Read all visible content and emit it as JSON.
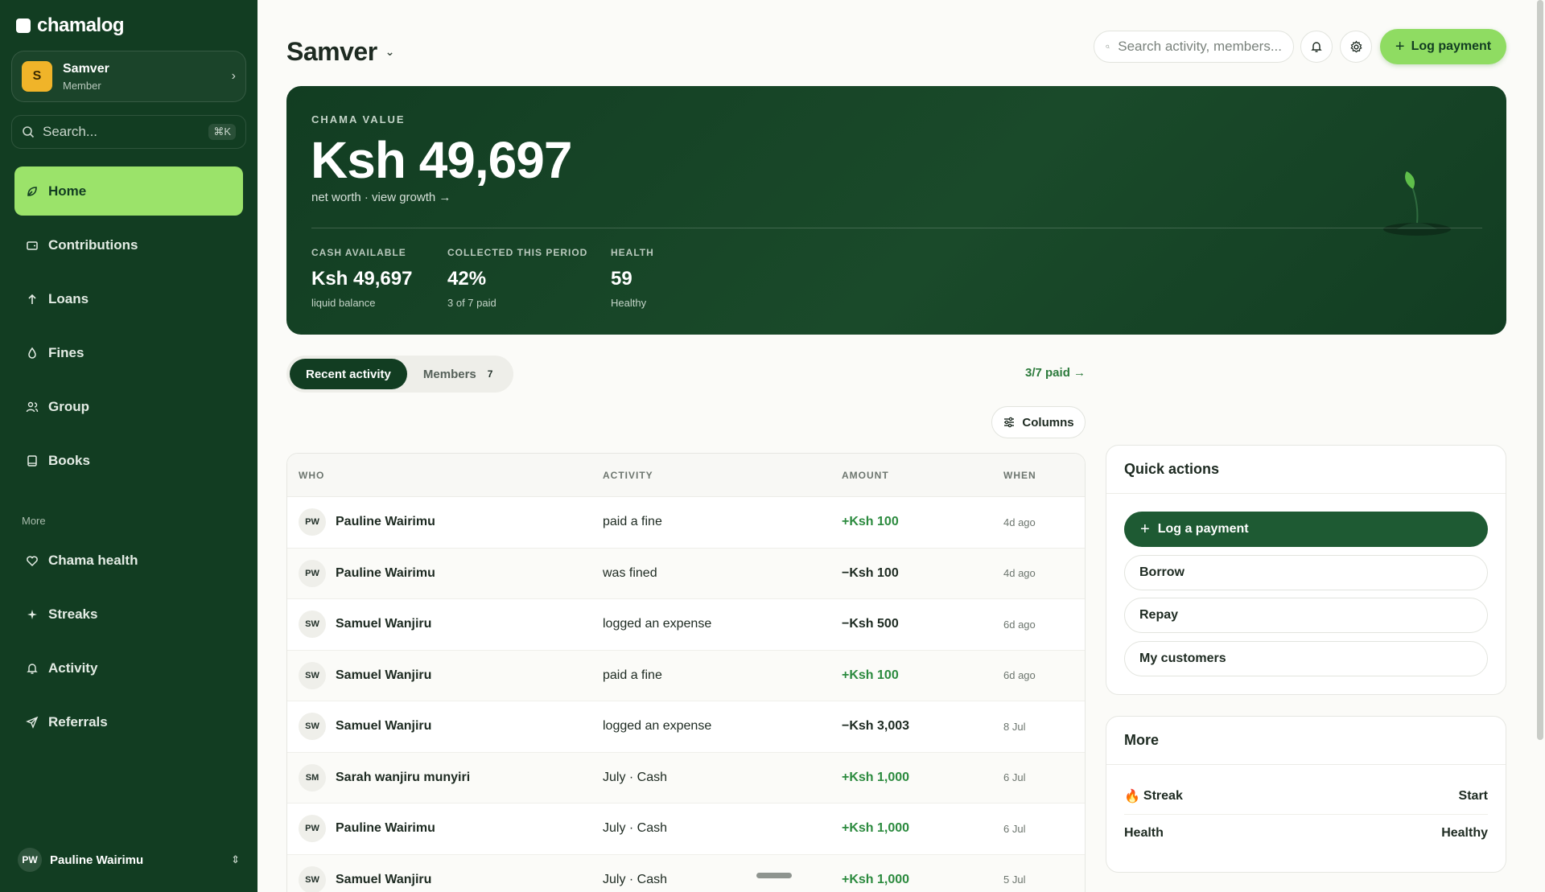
{
  "app": {
    "logo_text": "chamalog"
  },
  "sidebar": {
    "org": {
      "avatar_letter": "S",
      "name": "Samver",
      "role": "Member"
    },
    "search": {
      "placeholder": "Search...",
      "shortcut": "⌘K"
    },
    "nav": [
      {
        "label": "Home",
        "icon": "leaf-icon",
        "active": true
      },
      {
        "label": "Contributions",
        "icon": "wallet-icon"
      },
      {
        "label": "Loans",
        "icon": "arrow-up-icon"
      },
      {
        "label": "Fines",
        "icon": "droplet-icon"
      },
      {
        "label": "Group",
        "icon": "users-icon"
      },
      {
        "label": "Books",
        "icon": "book-icon"
      }
    ],
    "more_label": "More",
    "more_nav": [
      {
        "label": "Chama health",
        "icon": "heart-icon"
      },
      {
        "label": "Streaks",
        "icon": "sparkle-icon"
      },
      {
        "label": "Activity",
        "icon": "bell-icon"
      },
      {
        "label": "Referrals",
        "icon": "send-icon"
      }
    ],
    "user": {
      "initials": "PW",
      "name": "Pauline Wairimu"
    }
  },
  "header": {
    "title": "Samver",
    "search_placeholder": "Search activity, members...",
    "log_payment_label": "Log payment"
  },
  "hero": {
    "eyebrow": "CHAMA VALUE",
    "value": "Ksh 49,697",
    "subtitle": "net worth · view growth →",
    "stats": [
      {
        "label": "CASH AVAILABLE",
        "value": "Ksh 49,697",
        "caption": "liquid balance"
      },
      {
        "label": "COLLECTED THIS PERIOD",
        "value": "42%",
        "caption": "3 of 7 paid"
      },
      {
        "label": "HEALTH",
        "value": "59",
        "caption": "Healthy"
      }
    ]
  },
  "tabs": {
    "recent": "Recent activity",
    "members": "Members",
    "members_count": "7",
    "paid_link": "3/7 paid →",
    "columns_label": "Columns"
  },
  "table": {
    "headers": [
      "WHO",
      "ACTIVITY",
      "AMOUNT",
      "WHEN"
    ],
    "rows": [
      {
        "initials": "PW",
        "name": "Pauline Wairimu",
        "activity": "paid a fine",
        "amount": "+Ksh 100",
        "sign": "pos",
        "when": "4d ago"
      },
      {
        "initials": "PW",
        "name": "Pauline Wairimu",
        "activity": "was fined",
        "amount": "−Ksh 100",
        "sign": "neg",
        "when": "4d ago"
      },
      {
        "initials": "SW",
        "name": "Samuel Wanjiru",
        "activity": "logged an expense",
        "amount": "−Ksh 500",
        "sign": "neg",
        "when": "6d ago"
      },
      {
        "initials": "SW",
        "name": "Samuel Wanjiru",
        "activity": "paid a fine",
        "amount": "+Ksh 100",
        "sign": "pos",
        "when": "6d ago"
      },
      {
        "initials": "SW",
        "name": "Samuel Wanjiru",
        "activity": "logged an expense",
        "amount": "−Ksh 3,003",
        "sign": "neg",
        "when": "8 Jul"
      },
      {
        "initials": "SM",
        "name": "Sarah wanjiru munyiri",
        "activity": "July · Cash",
        "amount": "+Ksh 1,000",
        "sign": "pos",
        "when": "6 Jul"
      },
      {
        "initials": "PW",
        "name": "Pauline Wairimu",
        "activity": "July · Cash",
        "amount": "+Ksh 1,000",
        "sign": "pos",
        "when": "6 Jul"
      },
      {
        "initials": "SW",
        "name": "Samuel Wanjiru",
        "activity": "July · Cash",
        "amount": "+Ksh 1,000",
        "sign": "pos",
        "when": "5 Jul"
      }
    ]
  },
  "quick_actions": {
    "title": "Quick actions",
    "primary": "Log a payment",
    "items": [
      "Borrow",
      "Repay",
      "My customers"
    ]
  },
  "more_card": {
    "title": "More",
    "rows": [
      {
        "label": "Streak",
        "icon": "fire-icon",
        "value": "Start"
      },
      {
        "label": "Health",
        "value": "Healthy"
      }
    ]
  },
  "colors": {
    "sidebar_bg": "#123d22",
    "accent": "#8fdc62",
    "positive": "#2b8a3e"
  }
}
